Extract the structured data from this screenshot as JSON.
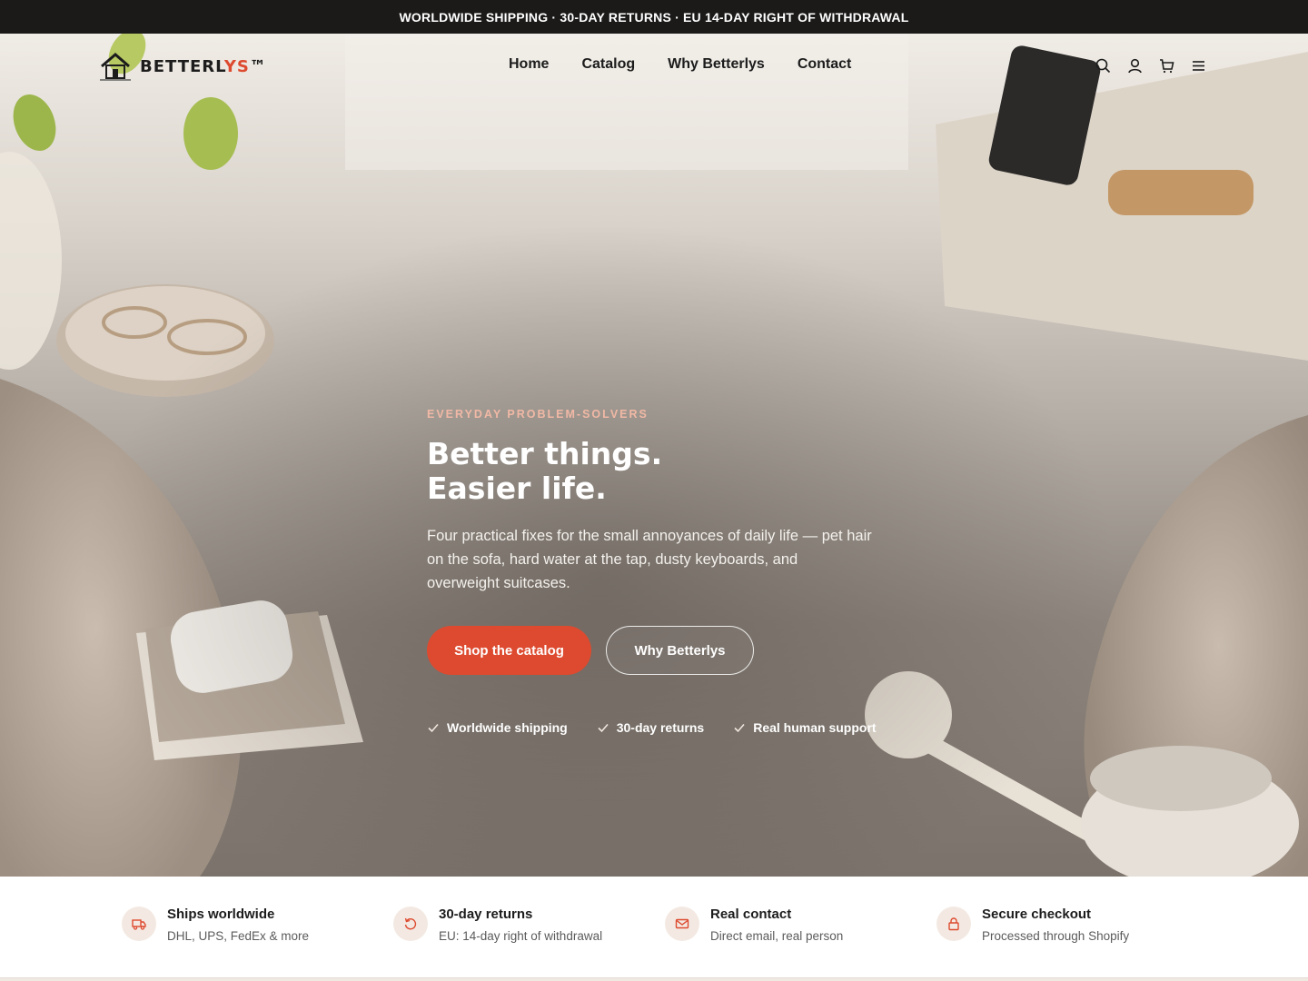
{
  "announcement": "WORLDWIDE SHIPPING · 30-DAY RETURNS · EU 14-DAY RIGHT OF WITHDRAWAL",
  "brand": {
    "name_main": "BETTERL",
    "name_accent": "YS",
    "name_tm": "™",
    "logo_icon": "house-icon"
  },
  "nav": {
    "items": [
      "Home",
      "Catalog",
      "Why Betterlys",
      "Contact"
    ]
  },
  "header_icons": [
    "search-icon",
    "account-icon",
    "cart-icon",
    "menu-icon"
  ],
  "hero": {
    "eyebrow": "EVERYDAY PROBLEM-SOLVERS",
    "title_line1": "Better things.",
    "title_line2": "Easier life.",
    "subtitle": "Four practical fixes for the small annoyances of daily life — pet hair on the sofa, hard water at the tap, dusty keyboards, and overweight suitcases.",
    "primary_cta": "Shop the catalog",
    "secondary_cta": "Why Betterlys",
    "checks": [
      "Worldwide shipping",
      "30-day returns",
      "Real human support"
    ]
  },
  "features": [
    {
      "icon": "truck-icon",
      "title": "Ships worldwide",
      "desc": "DHL, UPS, FedEx & more"
    },
    {
      "icon": "returns-icon",
      "title": "30-day returns",
      "desc": "EU: 14-day right of withdrawal"
    },
    {
      "icon": "mail-icon",
      "title": "Real contact",
      "desc": "Direct email, real person"
    },
    {
      "icon": "lock-icon",
      "title": "Secure checkout",
      "desc": "Processed through Shopify"
    }
  ],
  "colors": {
    "accent": "#dd4a2f",
    "announcement_bg": "#1b1a19",
    "eyebrow": "#f1b8a5",
    "feature_icon_bg": "#f3e9e2"
  }
}
